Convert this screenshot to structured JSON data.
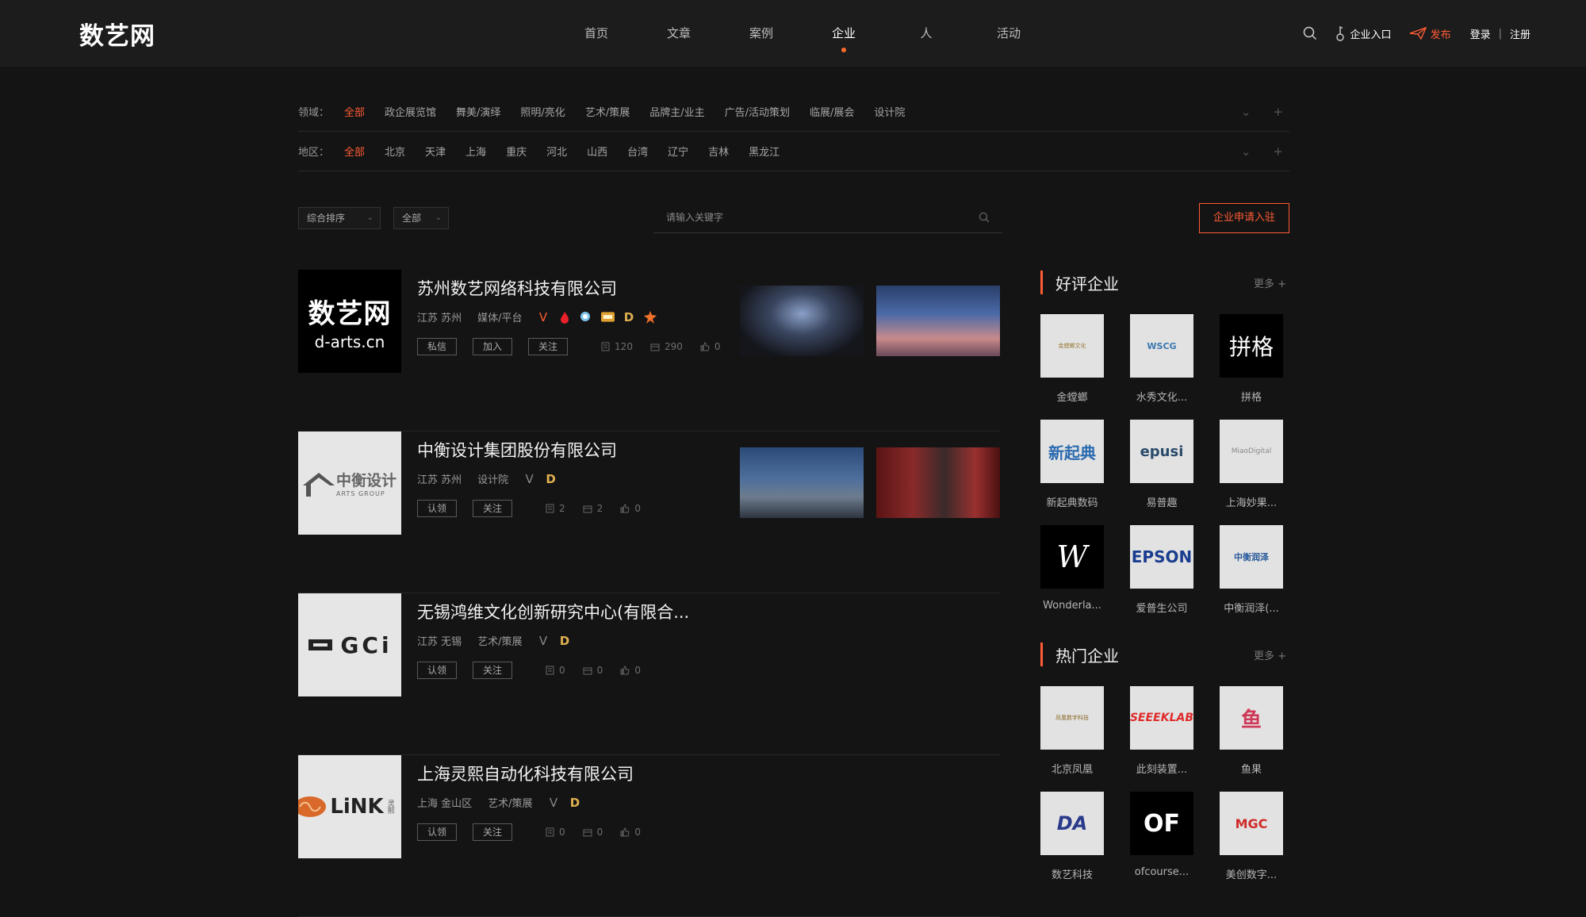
{
  "header": {
    "logo": "数艺网",
    "nav": [
      "首页",
      "文章",
      "案例",
      "企业",
      "人",
      "活动"
    ],
    "active_nav": "企业",
    "enterprise_entry": "企业入口",
    "publish": "发布",
    "login": "登录",
    "separator": "|",
    "register": "注册"
  },
  "filters": {
    "field_label": "领域：",
    "field_options": [
      "全部",
      "政企展览馆",
      "舞美/演绎",
      "照明/亮化",
      "艺术/策展",
      "品牌主/业主",
      "广告/活动策划",
      "临展/展会",
      "设计院"
    ],
    "region_label": "地区：",
    "region_options": [
      "全部",
      "北京",
      "天津",
      "上海",
      "重庆",
      "河北",
      "山西",
      "台湾",
      "辽宁",
      "吉林",
      "黑龙江"
    ]
  },
  "toolbar": {
    "sort": "综合排序",
    "scope": "全部",
    "search_placeholder": "请输入关键字",
    "apply_button": "企业申请入驻"
  },
  "companies": [
    {
      "name": "苏州数艺网络科技有限公司",
      "location": "江苏 苏州",
      "category": "媒体/平台",
      "logo_text": "数艺网",
      "logo_sub": "d-arts.cn",
      "actions": [
        "私信",
        "加入",
        "关注"
      ],
      "stats": [
        "120",
        "290",
        "0"
      ]
    },
    {
      "name": "中衡设计集团股份有限公司",
      "location": "江苏 苏州",
      "category": "设计院",
      "logo_text": "中衡设计",
      "logo_sub": "ARTS GROUP",
      "actions": [
        "认领",
        "关注"
      ],
      "stats": [
        "2",
        "2",
        "0"
      ]
    },
    {
      "name": "无锡鸿维文化创新研究中心(有限合...",
      "location": "江苏 无锡",
      "category": "艺术/策展",
      "logo_text": "GCi",
      "actions": [
        "认领",
        "关注"
      ],
      "stats": [
        "0",
        "0",
        "0"
      ]
    },
    {
      "name": "上海灵熙自动化科技有限公司",
      "location": "上海 金山区",
      "category": "艺术/策展",
      "logo_text": "LiNK",
      "logo_sub": "灵熙",
      "actions": [
        "认领",
        "关注"
      ],
      "stats": [
        "0",
        "0",
        "0"
      ]
    }
  ],
  "sidebar": {
    "top_rated": {
      "title": "好评企业",
      "more": "更多 +",
      "items": [
        "金螳螂",
        "水秀文化...",
        "拼格",
        "新起典数码",
        "易普趣",
        "上海妙果...",
        "Wonderla...",
        "爱普生公司",
        "中衡润泽(..."
      ]
    },
    "hot": {
      "title": "热门企业",
      "more": "更多 +",
      "items": [
        "北京凤凰",
        "此刻装置...",
        "鱼果",
        "数艺科技",
        "ofcourse...",
        "美创数字..."
      ]
    }
  },
  "logo_marks": {
    "top_rated": [
      "金螳螂文化",
      "WSCG",
      "拼格",
      "新起典",
      "epusi",
      "MiaoDigital",
      "W",
      "EPSON",
      "中衡润泽"
    ],
    "hot": [
      "凤凰数字科技",
      "SEEEKLAB",
      "鱼",
      "DA",
      "OF",
      "MGC"
    ]
  },
  "colors": {
    "accent": "#ff5c35",
    "background": "#141414",
    "header": "#1c1c1c"
  }
}
